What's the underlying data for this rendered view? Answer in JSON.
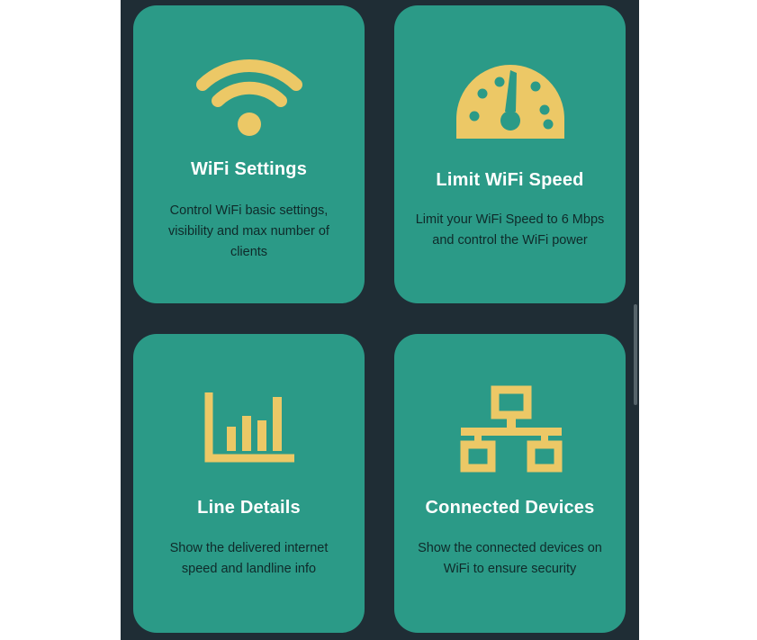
{
  "colors": {
    "background": "#1f2d35",
    "card": "#2b9a87",
    "icon": "#ecc866",
    "title": "#ffffff",
    "description": "#0f2a2a"
  },
  "cards": [
    {
      "icon": "wifi-icon",
      "title": "WiFi Settings",
      "description_lines": [
        "Control WiFi basic settings,",
        "visibility and max number of",
        "clients"
      ]
    },
    {
      "icon": "speedometer-icon",
      "title": "Limit WiFi Speed",
      "description_lines": [
        "Limit your WiFi Speed to 6 Mbps",
        "and control the WiFi power"
      ]
    },
    {
      "icon": "bar-chart-icon",
      "title": "Line Details",
      "description_lines": [
        "Show the delivered internet",
        "speed and landline info"
      ]
    },
    {
      "icon": "network-icon",
      "title": "Connected Devices",
      "description_lines": [
        "Show the connected devices on",
        "WiFi to ensure security"
      ]
    }
  ]
}
